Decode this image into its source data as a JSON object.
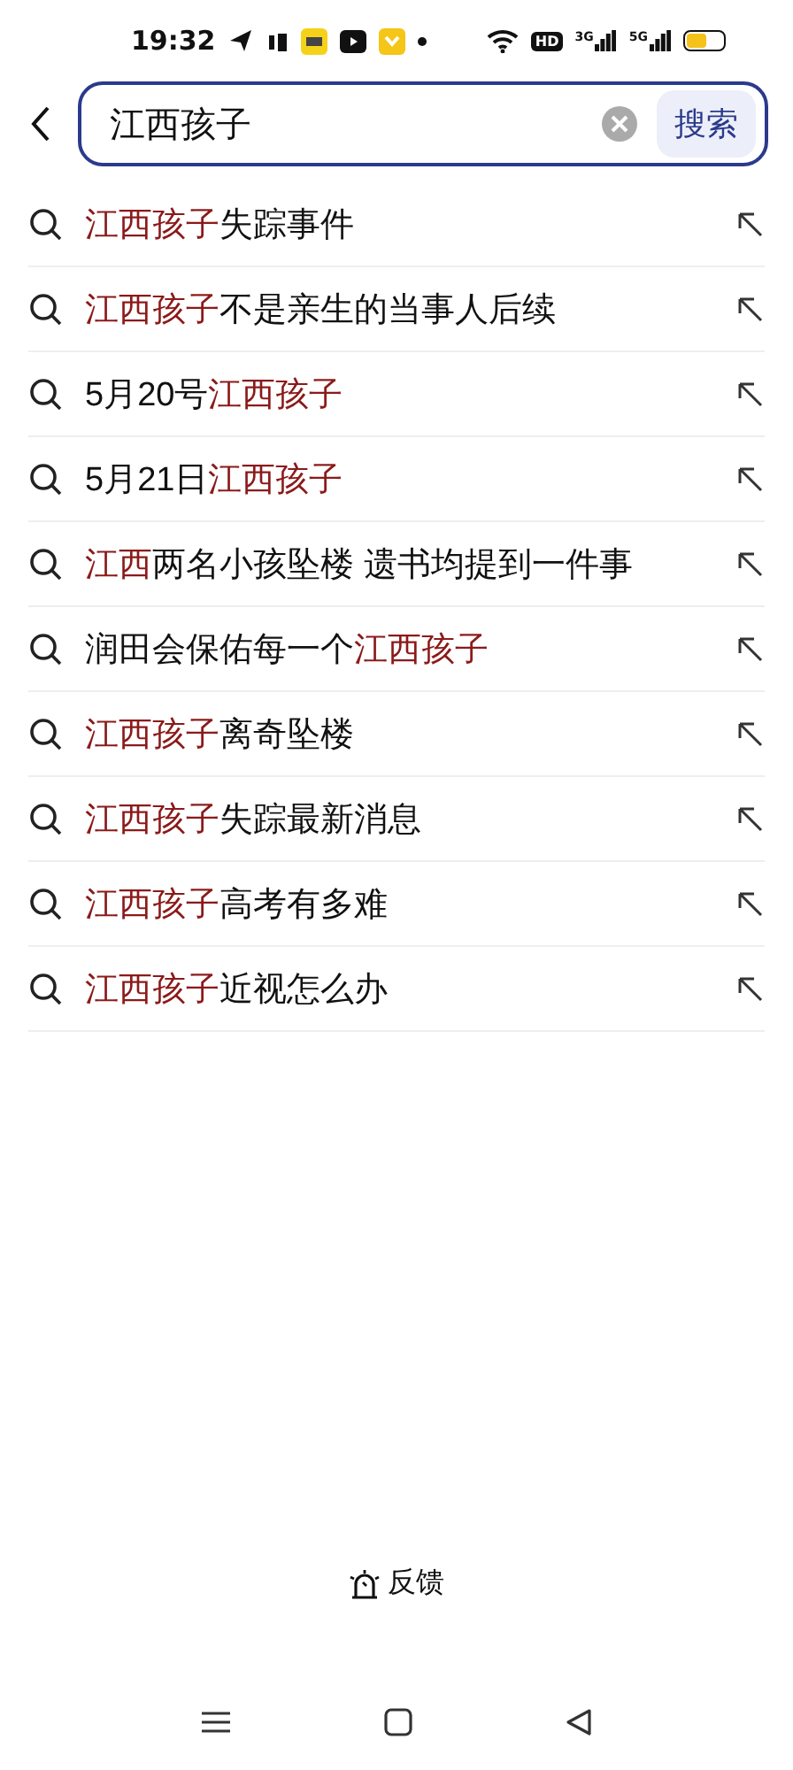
{
  "status_bar": {
    "time": "19:32",
    "hd_label": "HD",
    "signals": [
      {
        "label": "3G"
      },
      {
        "label": "5G"
      }
    ]
  },
  "search": {
    "value": "江西孩子",
    "button": "搜索"
  },
  "suggestions": [
    {
      "parts": [
        {
          "text": "江西孩子",
          "highlight": true
        },
        {
          "text": "失踪事件",
          "highlight": false
        }
      ]
    },
    {
      "parts": [
        {
          "text": "江西孩子",
          "highlight": true
        },
        {
          "text": "不是亲生的当事人后续",
          "highlight": false
        }
      ]
    },
    {
      "parts": [
        {
          "text": "5月20号",
          "highlight": false
        },
        {
          "text": "江西孩子",
          "highlight": true
        }
      ]
    },
    {
      "parts": [
        {
          "text": "5月21日",
          "highlight": false
        },
        {
          "text": "江西孩子",
          "highlight": true
        }
      ]
    },
    {
      "parts": [
        {
          "text": "江西",
          "highlight": true
        },
        {
          "text": "两名小孩坠楼 遗书均提到一件事",
          "highlight": false
        }
      ]
    },
    {
      "parts": [
        {
          "text": "润田会保佑每一个",
          "highlight": false
        },
        {
          "text": "江西孩子",
          "highlight": true
        }
      ]
    },
    {
      "parts": [
        {
          "text": "江西孩子",
          "highlight": true
        },
        {
          "text": "离奇坠楼",
          "highlight": false
        }
      ]
    },
    {
      "parts": [
        {
          "text": "江西孩子",
          "highlight": true
        },
        {
          "text": "失踪最新消息",
          "highlight": false
        }
      ]
    },
    {
      "parts": [
        {
          "text": "江西孩子",
          "highlight": true
        },
        {
          "text": "高考有多难",
          "highlight": false
        }
      ]
    },
    {
      "parts": [
        {
          "text": "江西孩子",
          "highlight": true
        },
        {
          "text": "近视怎么办",
          "highlight": false
        }
      ]
    }
  ],
  "feedback": "反馈"
}
